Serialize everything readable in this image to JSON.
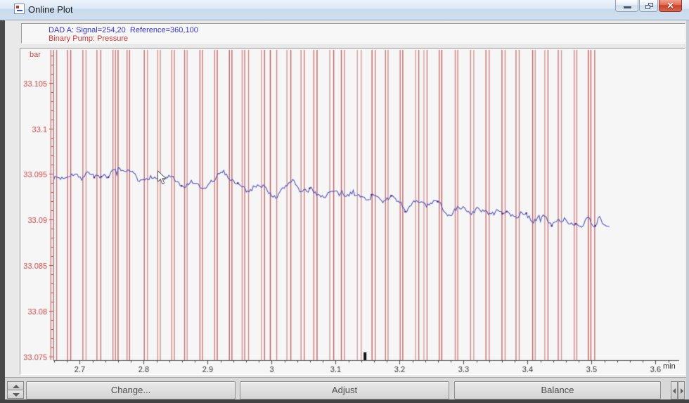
{
  "window": {
    "title": "Online Plot",
    "close_glyph": "✕"
  },
  "legend": {
    "dad_label": "DAD A: Signal=254,20  Reference=360,100",
    "pump_label": "Binary Pump: Pressure",
    "dad_color": "#3535c8",
    "pump_color": "#cc3a3a"
  },
  "bottom_bar": {
    "change_label": "Change...",
    "adjust_label": "Adjust",
    "balance_label": "Balance"
  },
  "chart_data": {
    "type": "line",
    "title": "",
    "xlabel": "min",
    "ylabel": "bar",
    "xlim": [
      2.659,
      3.637
    ],
    "ylim": [
      33.0746,
      33.1086
    ],
    "x_ticks": [
      2.7,
      2.8,
      2.9,
      3,
      3.1,
      3.2,
      3.3,
      3.4,
      3.5,
      3.6
    ],
    "x_tick_labels": [
      "2.7",
      "2.8",
      "2.9",
      "3",
      "3.1",
      "3.2",
      "3.3",
      "3.4",
      "3.5",
      "3.6"
    ],
    "x_minor_step": 0.02,
    "y_ticks": [
      33.105,
      33.1,
      33.095,
      33.09,
      33.085,
      33.08,
      33.075
    ],
    "y_tick_labels": [
      "33.105",
      "33.1",
      "33.095",
      "33.09",
      "33.085",
      "33.08",
      "33.075"
    ],
    "y_minor_step": 0.001,
    "grid": false,
    "time_marker_min": 3.146,
    "axis_color_x": "#555555",
    "axis_color_y": "#c04848",
    "series": [
      {
        "name": "DAD A: Signal=254,20  Reference=360,100",
        "style": "noisy-line",
        "color": "#5353b8",
        "dot_color": "#50288e",
        "noise_amplitude": 0.0005,
        "seed": 7,
        "anchors_t_bar": [
          [
            2.659,
            33.0947
          ],
          [
            2.67,
            33.0945
          ],
          [
            2.687,
            33.0952
          ],
          [
            2.703,
            33.0945
          ],
          [
            2.714,
            33.0953
          ],
          [
            2.731,
            33.0943
          ],
          [
            2.747,
            33.095
          ],
          [
            2.758,
            33.0956
          ],
          [
            2.769,
            33.0948
          ],
          [
            2.78,
            33.0953
          ],
          [
            2.791,
            33.0939
          ],
          [
            2.808,
            33.0949
          ],
          [
            2.824,
            33.0943
          ],
          [
            2.841,
            33.0947
          ],
          [
            2.857,
            33.0934
          ],
          [
            2.874,
            33.0941
          ],
          [
            2.89,
            33.0931
          ],
          [
            2.907,
            33.0943
          ],
          [
            2.923,
            33.0953
          ],
          [
            2.934,
            33.0945
          ],
          [
            2.945,
            33.094
          ],
          [
            2.962,
            33.093
          ],
          [
            2.978,
            33.0941
          ],
          [
            2.989,
            33.0935
          ],
          [
            3.005,
            33.0923
          ],
          [
            3.022,
            33.0938
          ],
          [
            3.033,
            33.0946
          ],
          [
            3.044,
            33.0928
          ],
          [
            3.06,
            33.0933
          ],
          [
            3.077,
            33.0925
          ],
          [
            3.093,
            33.0931
          ],
          [
            3.11,
            33.0925
          ],
          [
            3.126,
            33.093
          ],
          [
            3.143,
            33.0922
          ],
          [
            3.159,
            33.0928
          ],
          [
            3.176,
            33.092
          ],
          [
            3.192,
            33.0925
          ],
          [
            3.209,
            33.091
          ],
          [
            3.225,
            33.092
          ],
          [
            3.242,
            33.0915
          ],
          [
            3.258,
            33.092
          ],
          [
            3.275,
            33.0905
          ],
          [
            3.291,
            33.0915
          ],
          [
            3.308,
            33.0908
          ],
          [
            3.324,
            33.0912
          ],
          [
            3.341,
            33.0905
          ],
          [
            3.357,
            33.091
          ],
          [
            3.374,
            33.0902
          ],
          [
            3.39,
            33.0908
          ],
          [
            3.407,
            33.0899
          ],
          [
            3.423,
            33.0904
          ],
          [
            3.44,
            33.0894
          ],
          [
            3.456,
            33.0902
          ],
          [
            3.473,
            33.0894
          ],
          [
            3.484,
            33.0888
          ],
          [
            3.495,
            33.0906
          ],
          [
            3.502,
            33.0886
          ],
          [
            3.511,
            33.0907
          ],
          [
            3.52,
            33.0892
          ],
          [
            3.529,
            33.0894
          ]
        ]
      },
      {
        "name": "Binary Pump: Pressure",
        "style": "vertical-lines",
        "color": "#be4c4c",
        "seed": 11,
        "line_times_min": [
          2.655,
          2.659,
          2.664,
          2.681,
          2.686,
          2.705,
          2.71,
          2.727,
          2.733,
          2.752,
          2.756,
          2.76,
          2.774,
          2.778,
          2.801,
          2.806,
          2.822,
          2.826,
          2.844,
          2.848,
          2.864,
          2.868,
          2.888,
          2.892,
          2.911,
          2.915,
          2.934,
          2.938,
          2.954,
          2.958,
          2.964,
          2.984,
          2.989,
          2.998,
          3.008,
          3.024,
          3.03,
          3.046,
          3.051,
          3.066,
          3.071,
          3.091,
          3.097,
          3.109,
          3.114,
          3.134,
          3.14,
          3.157,
          3.162,
          3.178,
          3.182,
          3.201,
          3.205,
          3.225,
          3.23,
          3.238,
          3.243,
          3.262,
          3.266,
          3.287,
          3.291,
          3.311,
          3.316,
          3.335,
          3.34,
          3.36,
          3.365,
          3.382,
          3.387,
          3.408,
          3.412,
          3.427,
          3.432,
          3.448,
          3.453,
          3.473,
          3.477,
          3.495,
          3.499,
          3.505
        ]
      }
    ]
  }
}
